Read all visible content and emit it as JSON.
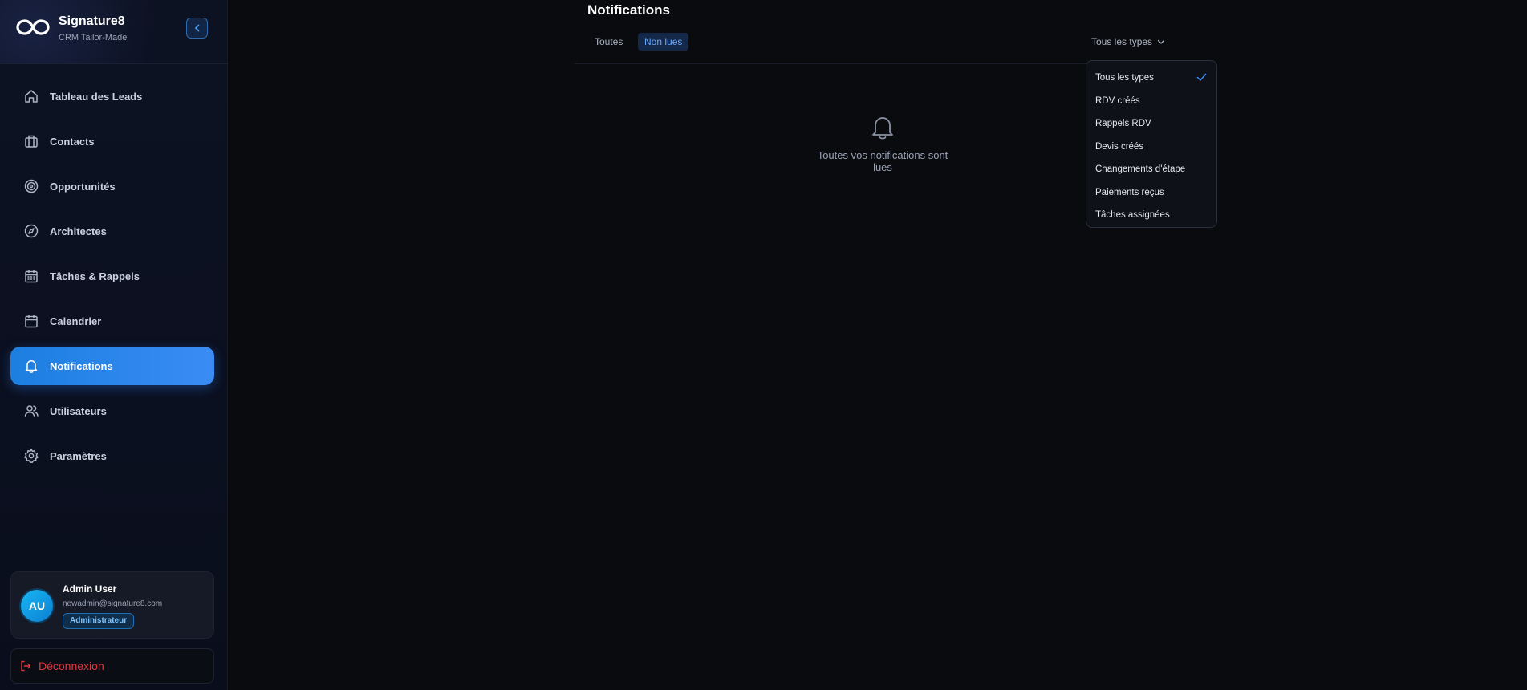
{
  "brand": {
    "name": "Signature8",
    "subtitle": "CRM Tailor-Made"
  },
  "sidebar": {
    "items": [
      {
        "label": "Tableau des Leads",
        "icon": "home-icon"
      },
      {
        "label": "Contacts",
        "icon": "briefcase-icon"
      },
      {
        "label": "Opportunités",
        "icon": "target-icon"
      },
      {
        "label": "Architectes",
        "icon": "compass-icon"
      },
      {
        "label": "Tâches & Rappels",
        "icon": "calendar-grid-icon"
      },
      {
        "label": "Calendrier",
        "icon": "calendar-icon"
      },
      {
        "label": "Notifications",
        "icon": "bell-icon",
        "active": true
      },
      {
        "label": "Utilisateurs",
        "icon": "users-icon"
      },
      {
        "label": "Paramètres",
        "icon": "gear-icon"
      }
    ]
  },
  "user": {
    "initials": "AU",
    "name": "Admin User",
    "email": "newadmin@signature8.com",
    "role": "Administrateur"
  },
  "logout_label": "Déconnexion",
  "main": {
    "title": "Notifications",
    "tabs": [
      {
        "label": "Toutes",
        "active": false
      },
      {
        "label": "Non lues",
        "active": true
      }
    ],
    "type_filter": {
      "selected": "Tous les types",
      "options": [
        "Tous les types",
        "RDV créés",
        "Rappels RDV",
        "Devis créés",
        "Changements d'étape",
        "Paiements reçus",
        "Tâches assignées"
      ]
    },
    "empty_message": "Toutes vos notifications sont lues"
  },
  "colors": {
    "accent": "#3a8cf4",
    "background": "#0a0b0f",
    "sidebar": "#0d1223",
    "danger": "#e2353e"
  }
}
